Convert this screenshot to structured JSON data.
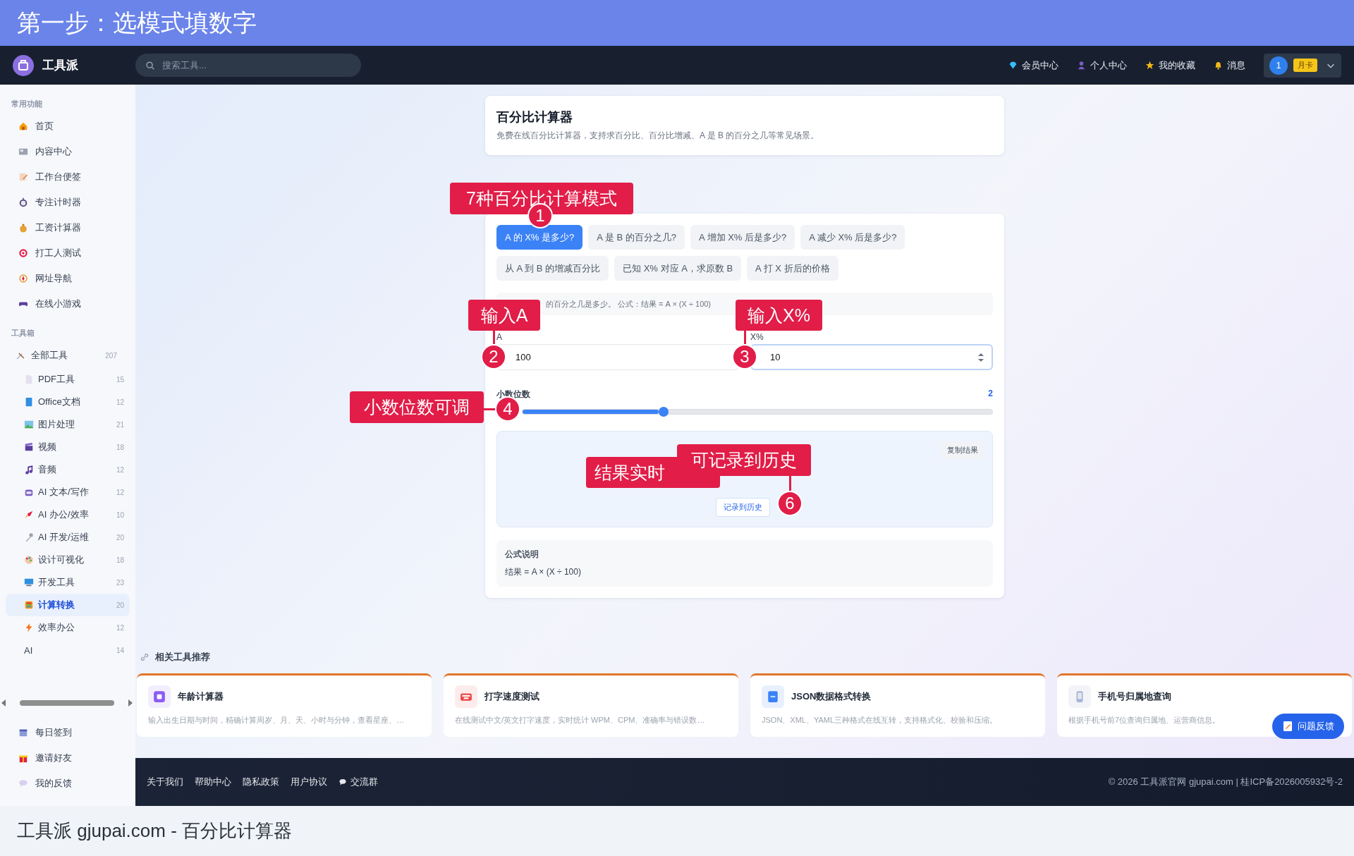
{
  "banner": {
    "title": "第一步：选模式填数字"
  },
  "nav": {
    "brand": "工具派",
    "search": {
      "placeholder": "搜索工具..."
    },
    "links": [
      {
        "label": "会员中心"
      },
      {
        "label": "个人中心"
      },
      {
        "label": "我的收藏"
      },
      {
        "label": "消息"
      }
    ],
    "user": {
      "avatar": "1",
      "badge": "月卡"
    }
  },
  "sidebar": {
    "sections": [
      {
        "heading": "常用功能",
        "items": [
          {
            "label": "首页",
            "selected": false
          },
          {
            "label": "内容中心",
            "selected": false
          },
          {
            "label": "工作台便签",
            "selected": false
          },
          {
            "label": "专注计时器",
            "selected": false
          },
          {
            "label": "工资计算器",
            "selected": false
          },
          {
            "label": "打工人测试",
            "selected": false
          },
          {
            "label": "网址导航",
            "selected": false
          },
          {
            "label": "在线小游戏",
            "selected": false
          }
        ]
      },
      {
        "heading": "工具箱",
        "items": [
          {
            "label": "全部工具",
            "count": "207",
            "selected": false,
            "children": [
              {
                "label": "PDF工具",
                "count": "15",
                "selected": false
              },
              {
                "label": "Office文档",
                "count": "12",
                "selected": false
              },
              {
                "label": "图片处理",
                "count": "21",
                "selected": false
              },
              {
                "label": "视频",
                "count": "18",
                "selected": false
              },
              {
                "label": "音频",
                "count": "12",
                "selected": false
              },
              {
                "label": "AI 文本/写作",
                "count": "12",
                "selected": false
              },
              {
                "label": "AI 办公/效率",
                "count": "10",
                "selected": false
              },
              {
                "label": "AI 开发/运维",
                "count": "20",
                "selected": false
              },
              {
                "label": "设计可视化",
                "count": "18",
                "selected": false
              },
              {
                "label": "开发工具",
                "count": "23",
                "selected": false
              },
              {
                "label": "计算转换",
                "count": "20",
                "selected": true
              },
              {
                "label": "效率办公",
                "count": "12",
                "selected": false
              },
              {
                "label": "AI",
                "count": "14",
                "selected": false
              }
            ]
          }
        ]
      }
    ],
    "bottom_items": [
      {
        "label": "每日签到",
        "selected": false
      },
      {
        "label": "邀请好友",
        "selected": false
      },
      {
        "label": "我的反馈",
        "selected": false
      }
    ]
  },
  "tool": {
    "title": "百分比计算器",
    "description": "免费在线百分比计算器，支持求百分比、百分比增减、A 是 B 的百分之几等常见场景。"
  },
  "modes": [
    {
      "label": "A 的 X% 是多少?",
      "selected": true
    },
    {
      "label": "A 是 B 的百分之几?",
      "selected": false
    },
    {
      "label": "A 增加 X% 后是多少?",
      "selected": false
    },
    {
      "label": "A 减少 X% 后是多少?",
      "selected": false
    },
    {
      "label": "从 A 到 B 的增减百分比",
      "selected": false
    },
    {
      "label": "已知 X% 对应 A，求原数 B",
      "selected": false
    },
    {
      "label": "A 打 X 折后的价格",
      "selected": false
    }
  ],
  "hint": "的百分之几是多少。 公式：结果 = A × (X ÷ 100)",
  "fields": [
    {
      "label": "A",
      "value": "100",
      "focused": false
    },
    {
      "label": "X%",
      "value": "10",
      "focused": true
    }
  ],
  "decimals": {
    "label": "小数位数",
    "reading": "2",
    "level": 0.3
  },
  "result": {
    "copy_button": "复制结果",
    "record_button": "记录到历史"
  },
  "formula": {
    "title": "公式说明",
    "text": "结果 = A × (X ÷ 100)"
  },
  "related": {
    "heading": "相关工具推荐",
    "cards": [
      {
        "title": "年龄计算器",
        "description": "输入出生日期与时间，精确计算周岁、月、天、小时与分钟，查看星座、…"
      },
      {
        "title": "打字速度测试",
        "description": "在线测试中文/英文打字速度，实时统计 WPM、CPM、准确率与错误数…"
      },
      {
        "title": "JSON数据格式转换",
        "description": "JSON、XML、YAML三种格式在线互转，支持格式化、校验和压缩。"
      },
      {
        "title": "手机号归属地查询",
        "description": "根据手机号前7位查询归属地、运营商信息。"
      }
    ]
  },
  "feedback_button": "问题反馈",
  "footer": {
    "links": [
      {
        "label": "关于我们"
      },
      {
        "label": "帮助中心"
      },
      {
        "label": "隐私政策"
      },
      {
        "label": "用户协议"
      },
      {
        "label": "交流群",
        "kind": "chat"
      }
    ],
    "copyright": "© 2026 工具派官网 gjupai.com | 桂ICP备2026005932号-2"
  },
  "annotations": [
    {
      "text": "7种百分比计算模式",
      "number": "1"
    },
    {
      "text": "输入A",
      "number": "2"
    },
    {
      "text": "输入X%",
      "number": "3"
    },
    {
      "text": "小数位数可调",
      "number": "4"
    },
    {
      "text": "结果实时"
    },
    {
      "text": "可记录到历史",
      "number": "6"
    }
  ],
  "caption": "工具派 gjupai.com - 百分比计算器"
}
